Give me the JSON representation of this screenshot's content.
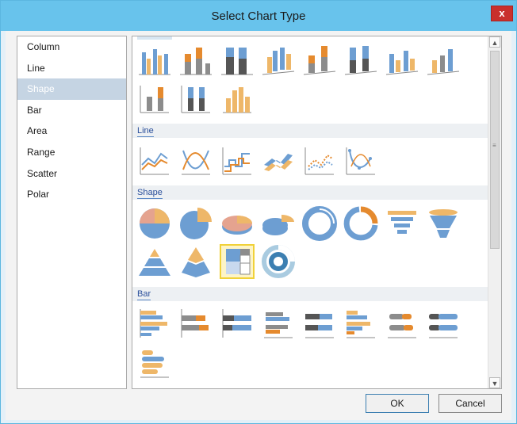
{
  "dialog": {
    "title": "Select Chart Type",
    "close_label": "x"
  },
  "categories": [
    {
      "label": "Column"
    },
    {
      "label": "Line"
    },
    {
      "label": "Shape"
    },
    {
      "label": "Bar"
    },
    {
      "label": "Area"
    },
    {
      "label": "Range"
    },
    {
      "label": "Scatter"
    },
    {
      "label": "Polar"
    }
  ],
  "selected_category": "Shape",
  "sections": {
    "line": "Line",
    "shape": "Shape",
    "bar": "Bar"
  },
  "buttons": {
    "ok": "OK",
    "cancel": "Cancel"
  },
  "colors": {
    "blue": "#6d9ed2",
    "orange": "#eeb769",
    "gray": "#8c8c8c",
    "dark_orange": "#e58a2e",
    "titlebar": "#68c3ec",
    "selection": "#f0d138"
  }
}
